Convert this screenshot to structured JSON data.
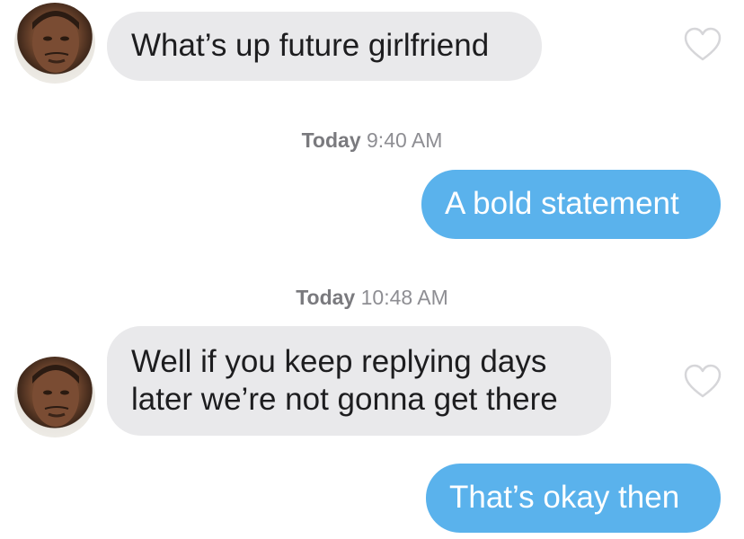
{
  "messages": [
    {
      "type": "incoming",
      "text": "What’s up future girlfriend"
    },
    {
      "type": "timestamp",
      "day": "Today",
      "time": "9:40 AM"
    },
    {
      "type": "outgoing",
      "text": "A bold statement"
    },
    {
      "type": "timestamp",
      "day": "Today",
      "time": "10:48 AM"
    },
    {
      "type": "incoming",
      "text_lines": [
        "Well if you keep replying days",
        "later we’re not gonna get there"
      ]
    },
    {
      "type": "outgoing",
      "text": "That’s okay then"
    }
  ],
  "colors": {
    "incoming_bubble": "#e9e9eb",
    "outgoing_bubble": "#5ab2ec",
    "timestamp_text": "#8e8e93",
    "heart_outline": "#d6d6d9"
  },
  "icons": {
    "like": "heart-outline-icon",
    "avatar": "contact-avatar"
  }
}
